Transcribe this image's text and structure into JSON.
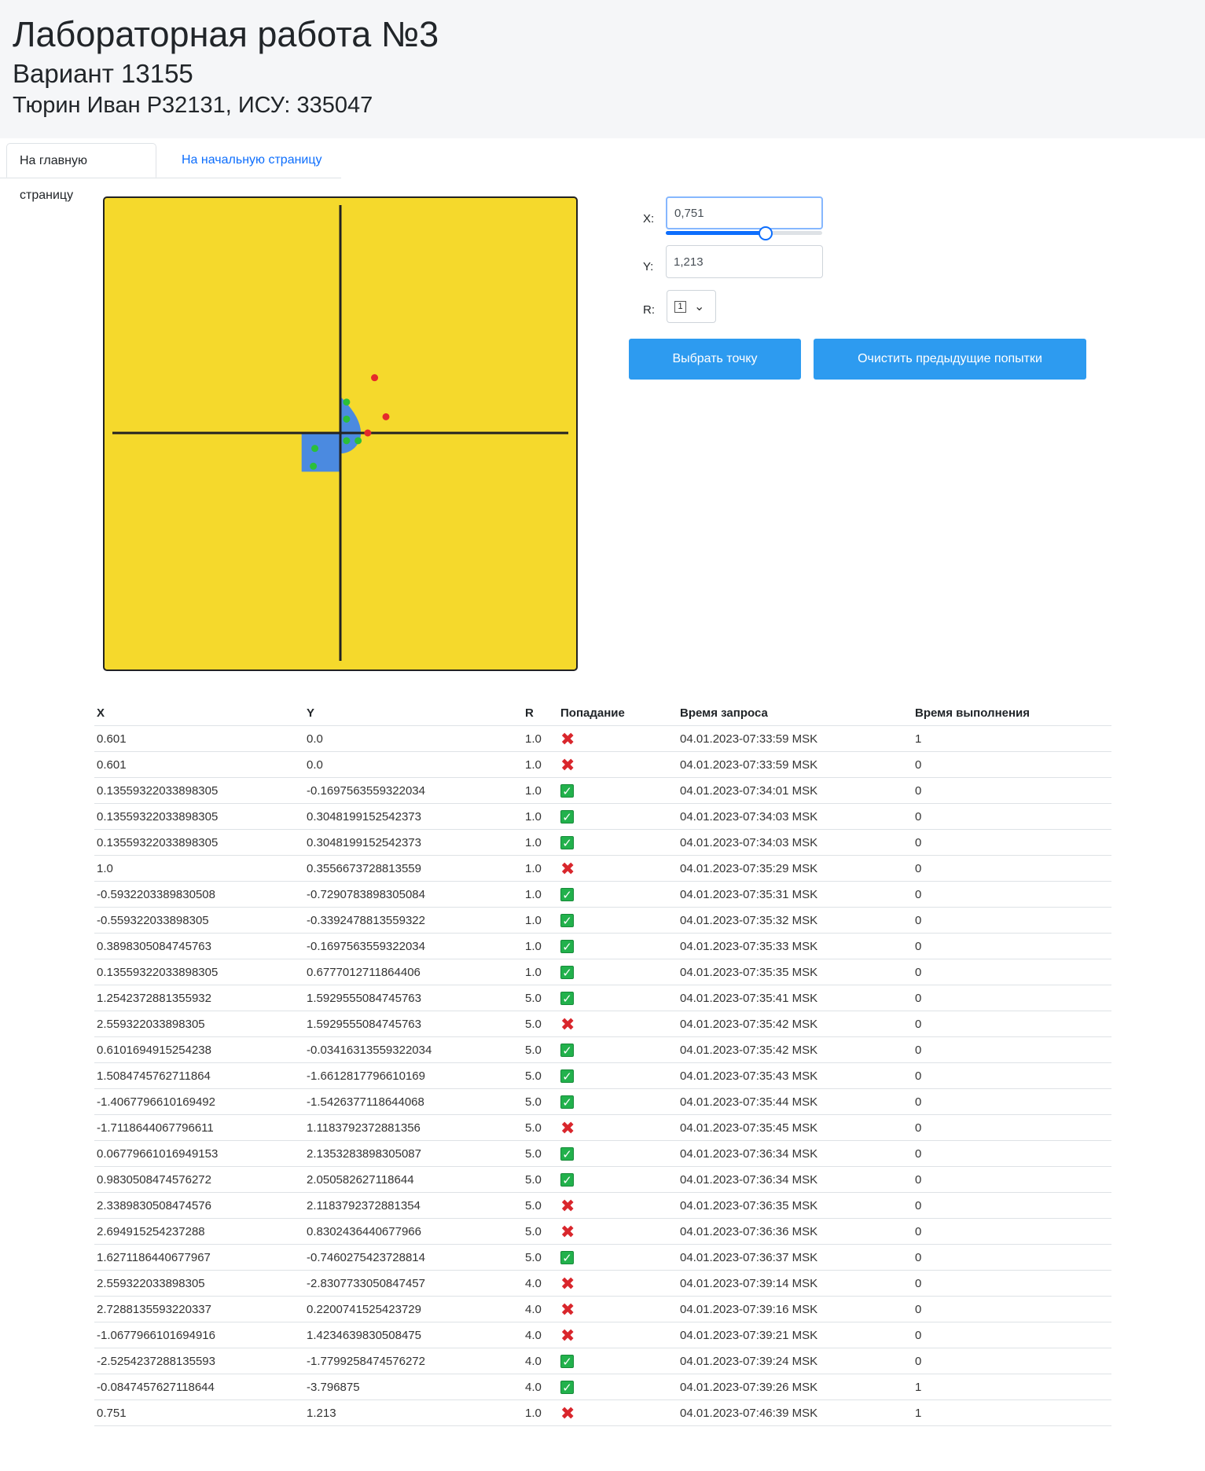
{
  "header": {
    "title": "Лабораторная работа №3",
    "variant": "Вариант 13155",
    "student": "Тюрин Иван P32131, ИСУ: 335047"
  },
  "tabs": [
    {
      "label": "На главную страницу"
    },
    {
      "label": "На начальную страницу"
    }
  ],
  "colors": {
    "plot_background": "#f5d92c",
    "area": "#4b8ae0",
    "hit_point": "#2bbf3a",
    "miss_point": "#e52b2b",
    "button": "#2d9bf0"
  },
  "plot": {
    "r": 1.0,
    "points": [
      {
        "x": 0.751,
        "y": 1.213,
        "hit": false
      },
      {
        "x": 1.0,
        "y": 0.3556673728813559,
        "hit": false
      },
      {
        "x": 0.601,
        "y": 0.0,
        "hit": false
      },
      {
        "x": 0.13559322033898305,
        "y": 0.6777012711864406,
        "hit": true
      },
      {
        "x": 0.13559322033898305,
        "y": 0.3048199152542373,
        "hit": true
      },
      {
        "x": 0.13559322033898305,
        "y": -0.1697563559322034,
        "hit": true
      },
      {
        "x": 0.3898305084745763,
        "y": -0.1697563559322034,
        "hit": true
      },
      {
        "x": -0.5932203389830508,
        "y": -0.7290783898305084,
        "hit": true
      },
      {
        "x": -0.559322033898305,
        "y": -0.3392478813559322,
        "hit": true
      }
    ]
  },
  "form": {
    "x_label": "X:",
    "x_value": "0,751",
    "x_slider_fraction": 0.64,
    "y_label": "Y:",
    "y_value": "1,213",
    "r_label": "R:",
    "r_selected": "1",
    "submit_label": "Выбрать точку",
    "clear_label": "Очистить предыдущие попытки"
  },
  "table": {
    "headers": [
      "X",
      "Y",
      "R",
      "Попадание",
      "Время запроса",
      "Время выполнения"
    ],
    "rows": [
      {
        "x": "0.601",
        "y": "0.0",
        "r": "1.0",
        "hit": false,
        "time": "04.01.2023-07:33:59 MSK",
        "exec": "1"
      },
      {
        "x": "0.601",
        "y": "0.0",
        "r": "1.0",
        "hit": false,
        "time": "04.01.2023-07:33:59 MSK",
        "exec": "0"
      },
      {
        "x": "0.13559322033898305",
        "y": "-0.1697563559322034",
        "r": "1.0",
        "hit": true,
        "time": "04.01.2023-07:34:01 MSK",
        "exec": "0"
      },
      {
        "x": "0.13559322033898305",
        "y": "0.3048199152542373",
        "r": "1.0",
        "hit": true,
        "time": "04.01.2023-07:34:03 MSK",
        "exec": "0"
      },
      {
        "x": "0.13559322033898305",
        "y": "0.3048199152542373",
        "r": "1.0",
        "hit": true,
        "time": "04.01.2023-07:34:03 MSK",
        "exec": "0"
      },
      {
        "x": "1.0",
        "y": "0.3556673728813559",
        "r": "1.0",
        "hit": false,
        "time": "04.01.2023-07:35:29 MSK",
        "exec": "0"
      },
      {
        "x": "-0.5932203389830508",
        "y": "-0.7290783898305084",
        "r": "1.0",
        "hit": true,
        "time": "04.01.2023-07:35:31 MSK",
        "exec": "0"
      },
      {
        "x": "-0.559322033898305",
        "y": "-0.3392478813559322",
        "r": "1.0",
        "hit": true,
        "time": "04.01.2023-07:35:32 MSK",
        "exec": "0"
      },
      {
        "x": "0.3898305084745763",
        "y": "-0.1697563559322034",
        "r": "1.0",
        "hit": true,
        "time": "04.01.2023-07:35:33 MSK",
        "exec": "0"
      },
      {
        "x": "0.13559322033898305",
        "y": "0.6777012711864406",
        "r": "1.0",
        "hit": true,
        "time": "04.01.2023-07:35:35 MSK",
        "exec": "0"
      },
      {
        "x": "1.2542372881355932",
        "y": "1.5929555084745763",
        "r": "5.0",
        "hit": true,
        "time": "04.01.2023-07:35:41 MSK",
        "exec": "0"
      },
      {
        "x": "2.559322033898305",
        "y": "1.5929555084745763",
        "r": "5.0",
        "hit": false,
        "time": "04.01.2023-07:35:42 MSK",
        "exec": "0"
      },
      {
        "x": "0.6101694915254238",
        "y": "-0.03416313559322034",
        "r": "5.0",
        "hit": true,
        "time": "04.01.2023-07:35:42 MSK",
        "exec": "0"
      },
      {
        "x": "1.5084745762711864",
        "y": "-1.6612817796610169",
        "r": "5.0",
        "hit": true,
        "time": "04.01.2023-07:35:43 MSK",
        "exec": "0"
      },
      {
        "x": "-1.4067796610169492",
        "y": "-1.5426377118644068",
        "r": "5.0",
        "hit": true,
        "time": "04.01.2023-07:35:44 MSK",
        "exec": "0"
      },
      {
        "x": "-1.7118644067796611",
        "y": "1.1183792372881356",
        "r": "5.0",
        "hit": false,
        "time": "04.01.2023-07:35:45 MSK",
        "exec": "0"
      },
      {
        "x": "0.06779661016949153",
        "y": "2.1353283898305087",
        "r": "5.0",
        "hit": true,
        "time": "04.01.2023-07:36:34 MSK",
        "exec": "0"
      },
      {
        "x": "0.9830508474576272",
        "y": "2.050582627118644",
        "r": "5.0",
        "hit": true,
        "time": "04.01.2023-07:36:34 MSK",
        "exec": "0"
      },
      {
        "x": "2.3389830508474576",
        "y": "2.1183792372881354",
        "r": "5.0",
        "hit": false,
        "time": "04.01.2023-07:36:35 MSK",
        "exec": "0"
      },
      {
        "x": "2.694915254237288",
        "y": "0.8302436440677966",
        "r": "5.0",
        "hit": false,
        "time": "04.01.2023-07:36:36 MSK",
        "exec": "0"
      },
      {
        "x": "1.6271186440677967",
        "y": "-0.7460275423728814",
        "r": "5.0",
        "hit": true,
        "time": "04.01.2023-07:36:37 MSK",
        "exec": "0"
      },
      {
        "x": "2.559322033898305",
        "y": "-2.8307733050847457",
        "r": "4.0",
        "hit": false,
        "time": "04.01.2023-07:39:14 MSK",
        "exec": "0"
      },
      {
        "x": "2.7288135593220337",
        "y": "0.2200741525423729",
        "r": "4.0",
        "hit": false,
        "time": "04.01.2023-07:39:16 MSK",
        "exec": "0"
      },
      {
        "x": "-1.0677966101694916",
        "y": "1.4234639830508475",
        "r": "4.0",
        "hit": false,
        "time": "04.01.2023-07:39:21 MSK",
        "exec": "0"
      },
      {
        "x": "-2.5254237288135593",
        "y": "-1.7799258474576272",
        "r": "4.0",
        "hit": true,
        "time": "04.01.2023-07:39:24 MSK",
        "exec": "0"
      },
      {
        "x": "-0.0847457627118644",
        "y": "-3.796875",
        "r": "4.0",
        "hit": true,
        "time": "04.01.2023-07:39:26 MSK",
        "exec": "1"
      },
      {
        "x": "0.751",
        "y": "1.213",
        "r": "1.0",
        "hit": false,
        "time": "04.01.2023-07:46:39 MSK",
        "exec": "1"
      }
    ]
  }
}
